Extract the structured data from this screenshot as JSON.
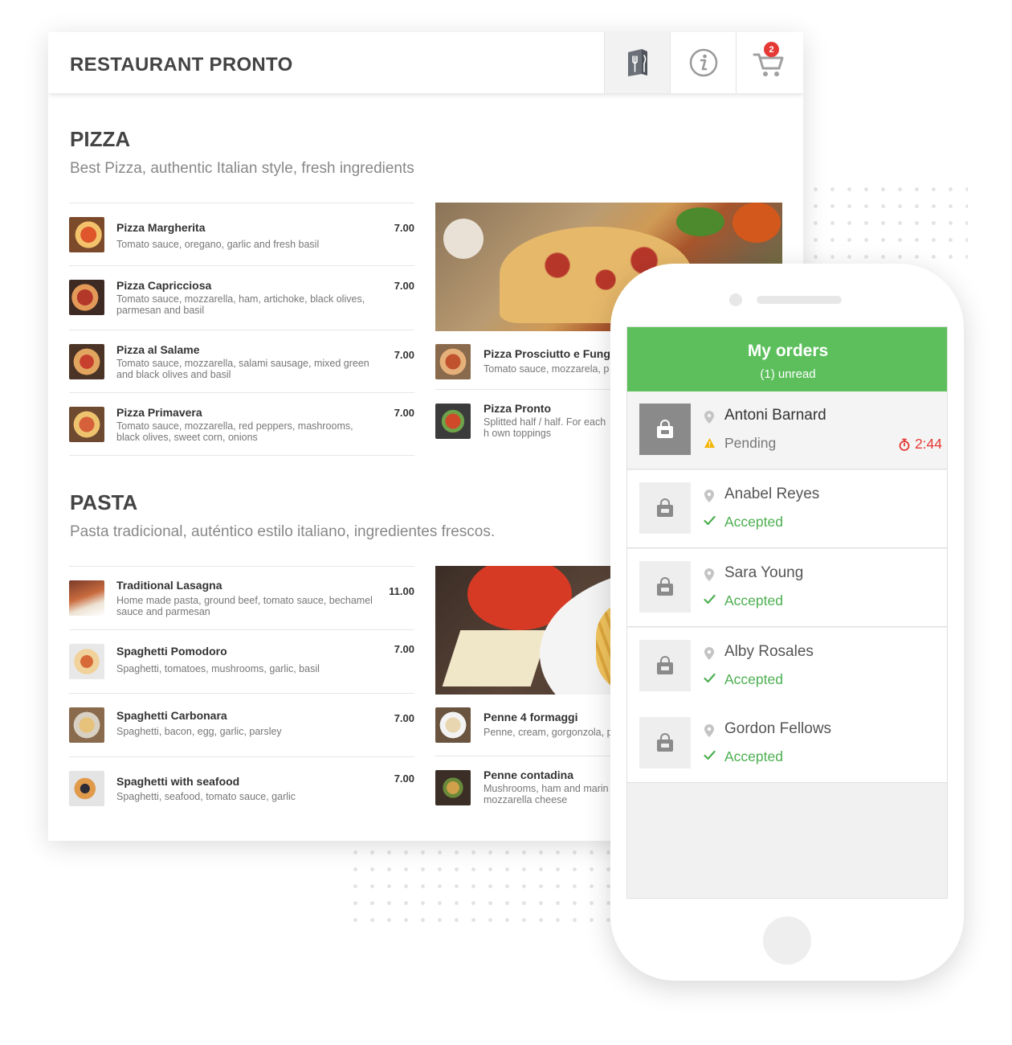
{
  "restaurant": {
    "name": "RESTAURANT PRONTO",
    "cart_count": "2"
  },
  "toolbar": {
    "menu_icon": "menu-book-icon",
    "info_icon": "info-icon",
    "cart_icon": "cart-icon"
  },
  "sections": [
    {
      "title": "PIZZA",
      "subtitle": "Best Pizza, authentic Italian style, fresh ingredients",
      "items": [
        {
          "name": "Pizza Margherita",
          "desc": "Tomato sauce, oregano, garlic and fresh basil",
          "price": "7.00"
        },
        {
          "name": "Pizza Capricciosa",
          "desc": "Tomato sauce, mozzarella, ham, artichoke, black olives, parmesan and basil",
          "price": "7.00"
        },
        {
          "name": "Pizza al Salame",
          "desc": "Tomato sauce, mozzarella, salami sausage, mixed green and black olives and basil",
          "price": "7.00"
        },
        {
          "name": "Pizza Primavera",
          "desc": "Tomato sauce, mozzarella, red peppers, mashrooms, black olives, sweet corn, onions",
          "price": "7.00"
        }
      ],
      "side_items": [
        {
          "name": "Pizza Prosciutto e Fung",
          "desc": "Tomato sauce, mozzarela, p"
        },
        {
          "name": "Pizza Pronto",
          "desc": "Splitted half / half. For each h own toppings"
        }
      ]
    },
    {
      "title": "PASTA",
      "subtitle": "Pasta tradicional, auténtico estilo italiano, ingredientes frescos.",
      "items": [
        {
          "name": "Traditional Lasagna",
          "desc": "Home made pasta, ground beef, tomato sauce, bechamel sauce and parmesan",
          "price": "11.00"
        },
        {
          "name": "Spaghetti Pomodoro",
          "desc": "Spaghetti, tomatoes, mushrooms, garlic, basil",
          "price": "7.00"
        },
        {
          "name": "Spaghetti Carbonara",
          "desc": "Spaghetti, bacon, egg, garlic, parsley",
          "price": "7.00"
        },
        {
          "name": "Spaghetti with seafood",
          "desc": "Spaghetti, seafood, tomato sauce, garlic",
          "price": "7.00"
        }
      ],
      "side_items": [
        {
          "name": "Penne 4 formaggi",
          "desc": "Penne, cream, gorgonzola, p"
        },
        {
          "name": "Penne contadina",
          "desc": "Mushrooms, ham and marin mozzarella cheese"
        }
      ]
    }
  ],
  "orders": {
    "title": "My orders",
    "unread": "(1) unread",
    "list": [
      {
        "name": "Antoni Barnard",
        "status": "Pending",
        "timer": "2:44"
      },
      {
        "name": "Anabel Reyes",
        "status": "Accepted"
      },
      {
        "name": "Sara Young",
        "status": "Accepted"
      },
      {
        "name": "Alby Rosales",
        "status": "Accepted"
      },
      {
        "name": "Gordon Fellows",
        "status": "Accepted"
      }
    ]
  },
  "colors": {
    "accent_green": "#5cbf5c",
    "alert_red": "#e53935",
    "warning": "#f4b400"
  }
}
